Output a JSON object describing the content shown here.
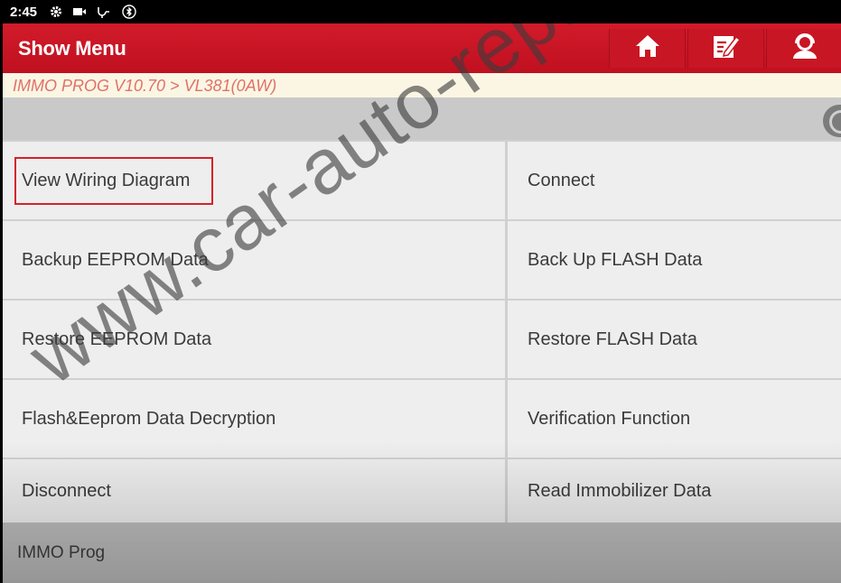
{
  "status_bar": {
    "time": "2:45",
    "icons": [
      "gear-icon",
      "video-icon",
      "usb-icon",
      "bluetooth-icon"
    ]
  },
  "header": {
    "title": "Show Menu",
    "buttons": [
      {
        "name": "home-button",
        "icon": "home-icon"
      },
      {
        "name": "report-button",
        "icon": "edit-report-icon"
      },
      {
        "name": "support-button",
        "icon": "headset-support-icon"
      }
    ],
    "accent_color": "#c81624"
  },
  "breadcrumb": {
    "text": "IMMO PROG V10.70 > VL381(0AW)"
  },
  "search": {
    "icon": "search-icon"
  },
  "menu": {
    "items": [
      {
        "label": "View Wiring Diagram",
        "highlighted": true
      },
      {
        "label": "Connect"
      },
      {
        "label": "Backup EEPROM Data"
      },
      {
        "label": "Back Up FLASH Data"
      },
      {
        "label": "Restore EEPROM Data"
      },
      {
        "label": "Restore FLASH Data"
      },
      {
        "label": "Flash&Eeprom Data Decryption"
      },
      {
        "label": "Verification Function"
      },
      {
        "label": "Disconnect"
      },
      {
        "label": "Read Immobilizer Data"
      }
    ]
  },
  "footer": {
    "label": "IMMO Prog"
  },
  "watermark": "www.car-auto-repair.com"
}
